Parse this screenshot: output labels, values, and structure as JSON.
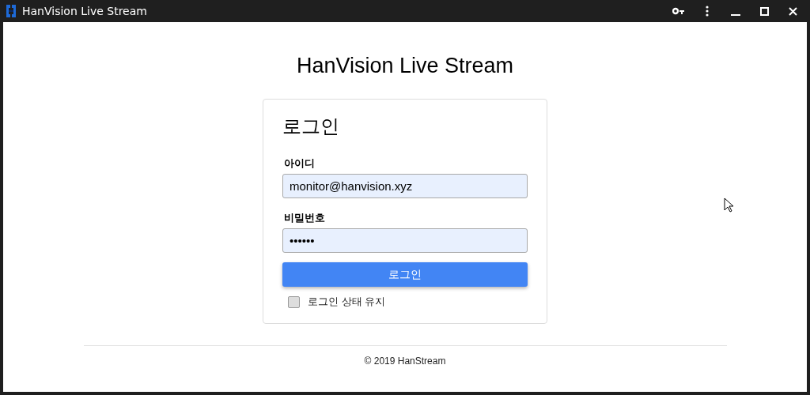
{
  "window": {
    "title": "HanVision Live Stream"
  },
  "page_title": "HanVision Live Stream",
  "login": {
    "heading": "로그인",
    "fields": [
      {
        "label": "아이디",
        "value": "monitor@hanvision.xyz"
      },
      {
        "label": "비밀번호",
        "value": "••••••"
      }
    ],
    "submit": "로그인",
    "remember": {
      "label": "로그인 상태 유지",
      "checked": false
    }
  },
  "footer": "© 2019 HanStream"
}
